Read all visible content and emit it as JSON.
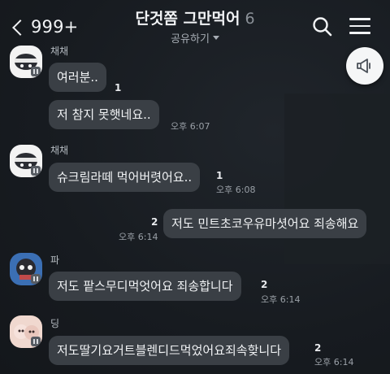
{
  "header": {
    "back_count": "999+",
    "title": "단것쫌 그만먹어",
    "member_count": "6",
    "subtitle": "공유하기"
  },
  "messages": [
    {
      "sender": "채채",
      "text": "여러분..",
      "unread": "1",
      "time": ""
    },
    {
      "sender": "",
      "text": "저 참지 못햇네요..",
      "unread": "",
      "time": "오후 6:07"
    },
    {
      "sender": "채채",
      "text": "슈크림라떼 먹어버렷어요..",
      "unread": "1",
      "time": "오후 6:08"
    },
    {
      "sender": "",
      "text": "저도 민트초코우유마셧어요 죄송해요",
      "unread": "2",
      "time": "오후 6:14"
    },
    {
      "sender": "파",
      "text": "저도 팥스무디먹엇어요 죄송합니다",
      "unread": "2",
      "time": "오후 6:14"
    },
    {
      "sender": "딩",
      "text": "저도딸기요거트블렌디드먹었어요죄속핮니다",
      "unread": "2",
      "time": "오후 6:14"
    }
  ],
  "icons": {
    "back": "chevron-left-icon",
    "search": "search-icon",
    "menu": "hamburger-menu-icon",
    "announce": "megaphone-icon"
  },
  "colors": {
    "background": "#171b20",
    "bubble": "#3a3f45",
    "text": "#f1f3f5",
    "announce_button": "#f5f6f7"
  }
}
